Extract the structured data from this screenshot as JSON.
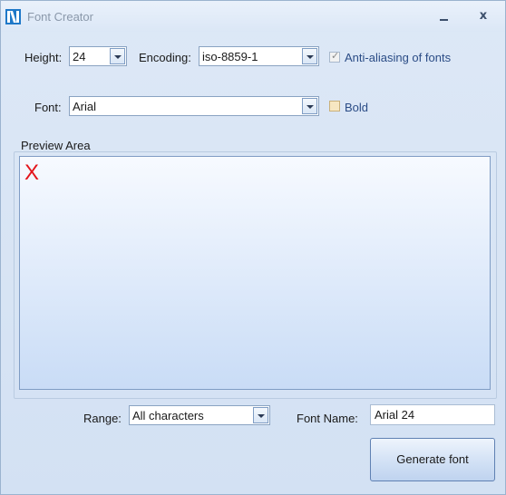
{
  "window": {
    "title": "Font Creator",
    "minimize_icon": "minimize-icon",
    "close_label": "x"
  },
  "height": {
    "label": "Height:",
    "value": "24"
  },
  "encoding": {
    "label": "Encoding:",
    "value": "iso-8859-1"
  },
  "antialias": {
    "label": "Anti-aliasing of fonts",
    "checked": true
  },
  "font": {
    "label": "Font:",
    "value": "Arial"
  },
  "bold": {
    "label": "Bold",
    "checked": false
  },
  "preview": {
    "title": "Preview Area",
    "glyph": "X",
    "glyph_color": "#e4141b"
  },
  "range": {
    "label": "Range:",
    "value": "All characters"
  },
  "font_name": {
    "label": "Font Name:",
    "value": "Arial 24"
  },
  "generate_button": {
    "label": "Generate font"
  },
  "colors": {
    "accent": "#2b4c86",
    "background": "#d8e4f4"
  }
}
